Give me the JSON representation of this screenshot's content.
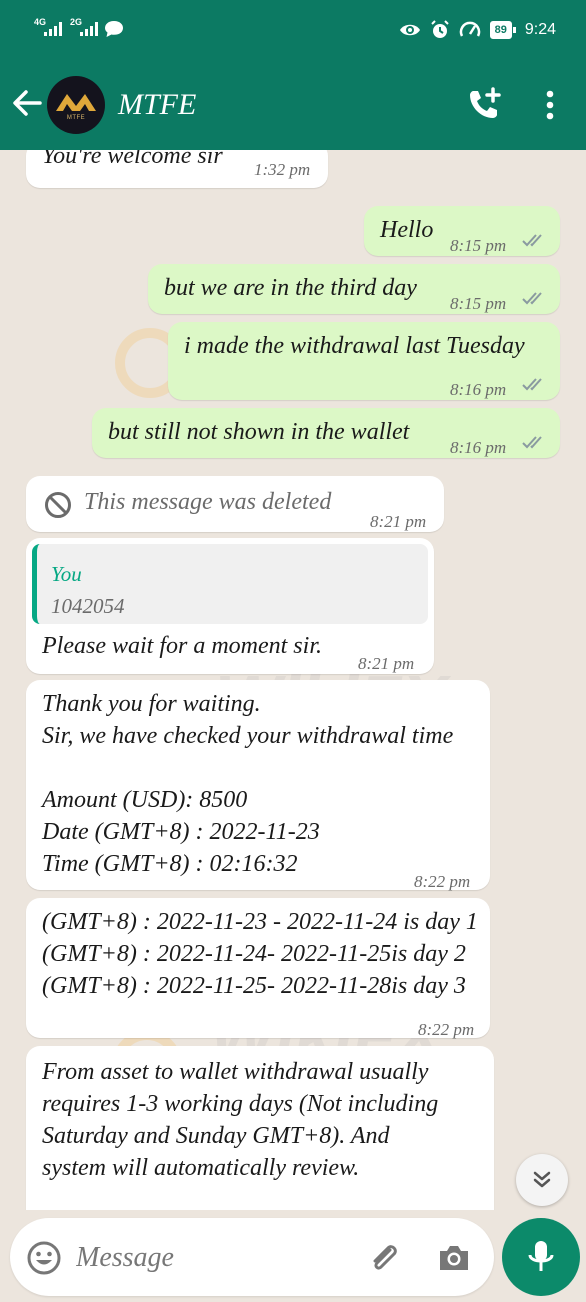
{
  "status_bar": {
    "sim1_label": "4G",
    "sim2_label": "2G",
    "battery": "89",
    "time": "9:24"
  },
  "header": {
    "title": "MTFE",
    "avatar_label": "MTFE"
  },
  "messages": [
    {
      "direction": "incoming",
      "text": "You're welcome sir",
      "time": "1:32 pm"
    },
    {
      "direction": "outgoing",
      "text": "Hello",
      "time": "8:15 pm",
      "status": "read"
    },
    {
      "direction": "outgoing",
      "text": "but we are in the third day",
      "time": "8:15 pm",
      "status": "read"
    },
    {
      "direction": "outgoing",
      "text": "i made the withdrawal last Tuesday",
      "time": "8:16 pm",
      "status": "read"
    },
    {
      "direction": "outgoing",
      "text": "but still not shown in the wallet",
      "time": "8:16 pm",
      "status": "read"
    },
    {
      "direction": "incoming",
      "text": "This message was deleted",
      "time": "8:21 pm",
      "deleted": true
    },
    {
      "direction": "incoming",
      "reply_to": {
        "name": "You",
        "text": "1042054"
      },
      "text": "Please wait for a moment sir.",
      "time": "8:21 pm"
    },
    {
      "direction": "incoming",
      "text": "Thank you for waiting.\nSir, we have checked your withdrawal time\n\nAmount (USD): 8500\nDate (GMT+8) : 2022-11-23\nTime (GMT+8) : 02:16:32",
      "time": "8:22 pm"
    },
    {
      "direction": "incoming",
      "text": "(GMT+8) : 2022-11-23 - 2022-11-24 is day 1\n(GMT+8) : 2022-11-24- 2022-11-25is day 2\n(GMT+8) : 2022-11-25- 2022-11-28is day 3",
      "time": "8:22 pm"
    },
    {
      "direction": "incoming",
      "text": "From asset to wallet withdrawal usually\nrequires 1-3 working days (Not including\nSaturday and Sunday GMT+8). And\nsystem will automatically review.",
      "time": ""
    }
  ],
  "input": {
    "placeholder": "Message"
  },
  "watermark": "WikiFX",
  "colors": {
    "header": "#0c7a63",
    "outgoing_bubble": "#dcf8c6",
    "incoming_bubble": "#ffffff",
    "read_ticks": "#8a9aa0",
    "accent": "#06a884"
  },
  "icons": [
    "back-arrow-icon",
    "add-call-icon",
    "more-vert-icon",
    "blocked-icon",
    "double-check-icon",
    "chevron-down-icon",
    "emoji-icon",
    "paperclip-icon",
    "camera-icon",
    "mic-icon"
  ]
}
